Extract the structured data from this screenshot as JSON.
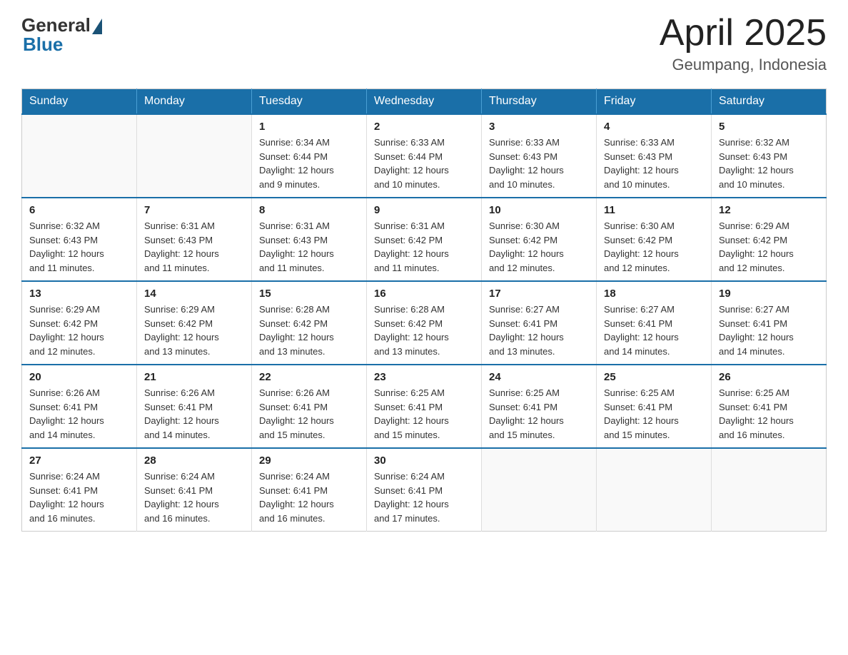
{
  "logo": {
    "general": "General",
    "blue": "Blue"
  },
  "title": {
    "month_year": "April 2025",
    "location": "Geumpang, Indonesia"
  },
  "weekdays": [
    "Sunday",
    "Monday",
    "Tuesday",
    "Wednesday",
    "Thursday",
    "Friday",
    "Saturday"
  ],
  "weeks": [
    [
      {
        "day": "",
        "info": ""
      },
      {
        "day": "",
        "info": ""
      },
      {
        "day": "1",
        "info": "Sunrise: 6:34 AM\nSunset: 6:44 PM\nDaylight: 12 hours\nand 9 minutes."
      },
      {
        "day": "2",
        "info": "Sunrise: 6:33 AM\nSunset: 6:44 PM\nDaylight: 12 hours\nand 10 minutes."
      },
      {
        "day": "3",
        "info": "Sunrise: 6:33 AM\nSunset: 6:43 PM\nDaylight: 12 hours\nand 10 minutes."
      },
      {
        "day": "4",
        "info": "Sunrise: 6:33 AM\nSunset: 6:43 PM\nDaylight: 12 hours\nand 10 minutes."
      },
      {
        "day": "5",
        "info": "Sunrise: 6:32 AM\nSunset: 6:43 PM\nDaylight: 12 hours\nand 10 minutes."
      }
    ],
    [
      {
        "day": "6",
        "info": "Sunrise: 6:32 AM\nSunset: 6:43 PM\nDaylight: 12 hours\nand 11 minutes."
      },
      {
        "day": "7",
        "info": "Sunrise: 6:31 AM\nSunset: 6:43 PM\nDaylight: 12 hours\nand 11 minutes."
      },
      {
        "day": "8",
        "info": "Sunrise: 6:31 AM\nSunset: 6:43 PM\nDaylight: 12 hours\nand 11 minutes."
      },
      {
        "day": "9",
        "info": "Sunrise: 6:31 AM\nSunset: 6:42 PM\nDaylight: 12 hours\nand 11 minutes."
      },
      {
        "day": "10",
        "info": "Sunrise: 6:30 AM\nSunset: 6:42 PM\nDaylight: 12 hours\nand 12 minutes."
      },
      {
        "day": "11",
        "info": "Sunrise: 6:30 AM\nSunset: 6:42 PM\nDaylight: 12 hours\nand 12 minutes."
      },
      {
        "day": "12",
        "info": "Sunrise: 6:29 AM\nSunset: 6:42 PM\nDaylight: 12 hours\nand 12 minutes."
      }
    ],
    [
      {
        "day": "13",
        "info": "Sunrise: 6:29 AM\nSunset: 6:42 PM\nDaylight: 12 hours\nand 12 minutes."
      },
      {
        "day": "14",
        "info": "Sunrise: 6:29 AM\nSunset: 6:42 PM\nDaylight: 12 hours\nand 13 minutes."
      },
      {
        "day": "15",
        "info": "Sunrise: 6:28 AM\nSunset: 6:42 PM\nDaylight: 12 hours\nand 13 minutes."
      },
      {
        "day": "16",
        "info": "Sunrise: 6:28 AM\nSunset: 6:42 PM\nDaylight: 12 hours\nand 13 minutes."
      },
      {
        "day": "17",
        "info": "Sunrise: 6:27 AM\nSunset: 6:41 PM\nDaylight: 12 hours\nand 13 minutes."
      },
      {
        "day": "18",
        "info": "Sunrise: 6:27 AM\nSunset: 6:41 PM\nDaylight: 12 hours\nand 14 minutes."
      },
      {
        "day": "19",
        "info": "Sunrise: 6:27 AM\nSunset: 6:41 PM\nDaylight: 12 hours\nand 14 minutes."
      }
    ],
    [
      {
        "day": "20",
        "info": "Sunrise: 6:26 AM\nSunset: 6:41 PM\nDaylight: 12 hours\nand 14 minutes."
      },
      {
        "day": "21",
        "info": "Sunrise: 6:26 AM\nSunset: 6:41 PM\nDaylight: 12 hours\nand 14 minutes."
      },
      {
        "day": "22",
        "info": "Sunrise: 6:26 AM\nSunset: 6:41 PM\nDaylight: 12 hours\nand 15 minutes."
      },
      {
        "day": "23",
        "info": "Sunrise: 6:25 AM\nSunset: 6:41 PM\nDaylight: 12 hours\nand 15 minutes."
      },
      {
        "day": "24",
        "info": "Sunrise: 6:25 AM\nSunset: 6:41 PM\nDaylight: 12 hours\nand 15 minutes."
      },
      {
        "day": "25",
        "info": "Sunrise: 6:25 AM\nSunset: 6:41 PM\nDaylight: 12 hours\nand 15 minutes."
      },
      {
        "day": "26",
        "info": "Sunrise: 6:25 AM\nSunset: 6:41 PM\nDaylight: 12 hours\nand 16 minutes."
      }
    ],
    [
      {
        "day": "27",
        "info": "Sunrise: 6:24 AM\nSunset: 6:41 PM\nDaylight: 12 hours\nand 16 minutes."
      },
      {
        "day": "28",
        "info": "Sunrise: 6:24 AM\nSunset: 6:41 PM\nDaylight: 12 hours\nand 16 minutes."
      },
      {
        "day": "29",
        "info": "Sunrise: 6:24 AM\nSunset: 6:41 PM\nDaylight: 12 hours\nand 16 minutes."
      },
      {
        "day": "30",
        "info": "Sunrise: 6:24 AM\nSunset: 6:41 PM\nDaylight: 12 hours\nand 17 minutes."
      },
      {
        "day": "",
        "info": ""
      },
      {
        "day": "",
        "info": ""
      },
      {
        "day": "",
        "info": ""
      }
    ]
  ]
}
